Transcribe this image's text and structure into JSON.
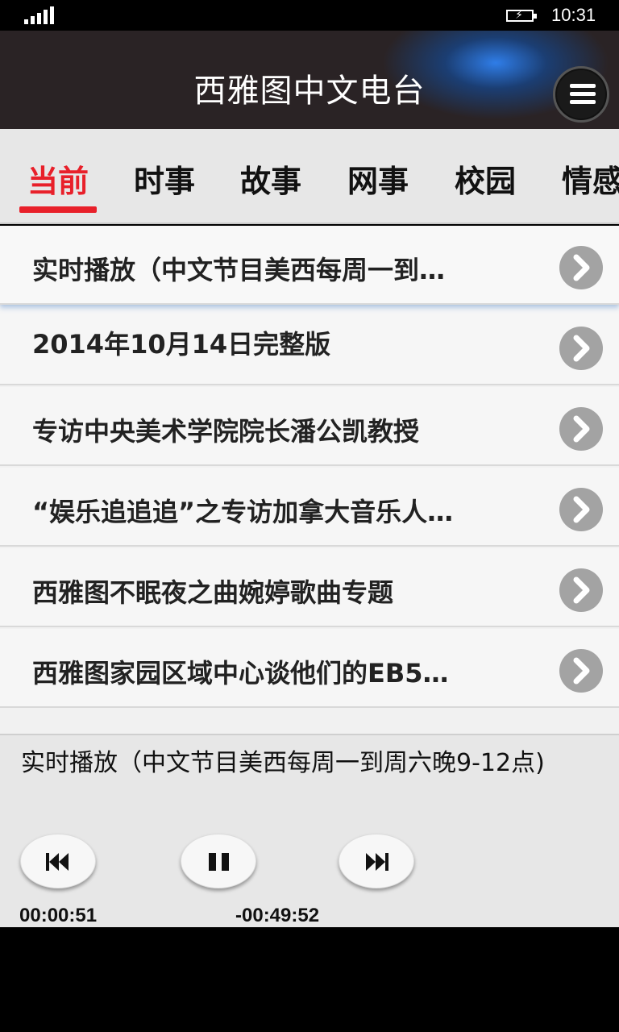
{
  "status_bar": {
    "time": "10:31",
    "signal_icon": "signal-bars-icon",
    "battery_icon": "battery-charging-icon"
  },
  "header": {
    "title": "西雅图中文电台",
    "menu_icon": "hamburger-menu-icon"
  },
  "tabs": [
    {
      "label": "当前",
      "active": true
    },
    {
      "label": "时事",
      "active": false
    },
    {
      "label": "故事",
      "active": false
    },
    {
      "label": "网事",
      "active": false
    },
    {
      "label": "校园",
      "active": false
    },
    {
      "label": "情感",
      "active": false
    }
  ],
  "list": {
    "items": [
      {
        "label": "实时播放（中文节目美西每周一到…"
      },
      {
        "label": "2014年10月14日完整版"
      },
      {
        "label": "专访中央美术学院院长潘公凯教授"
      },
      {
        "label": "“娱乐追追追”之专访加拿大音乐人…"
      },
      {
        "label": "西雅图不眠夜之曲婉婷歌曲专题"
      },
      {
        "label": "西雅图家园区域中心谈他们的EB5…"
      }
    ],
    "chevron_icon": "chevron-right-icon"
  },
  "player": {
    "now_playing": "实时播放（中文节目美西每周一到周六晚9-12点)",
    "elapsed": "00:00:51",
    "remaining": "-00:49:52",
    "controls": [
      "previous-track-icon",
      "pause-icon",
      "next-track-icon"
    ]
  },
  "colors": {
    "accent": "#e8202a",
    "header_bg": "#2a2325",
    "header_glow": "#2f7de8"
  }
}
